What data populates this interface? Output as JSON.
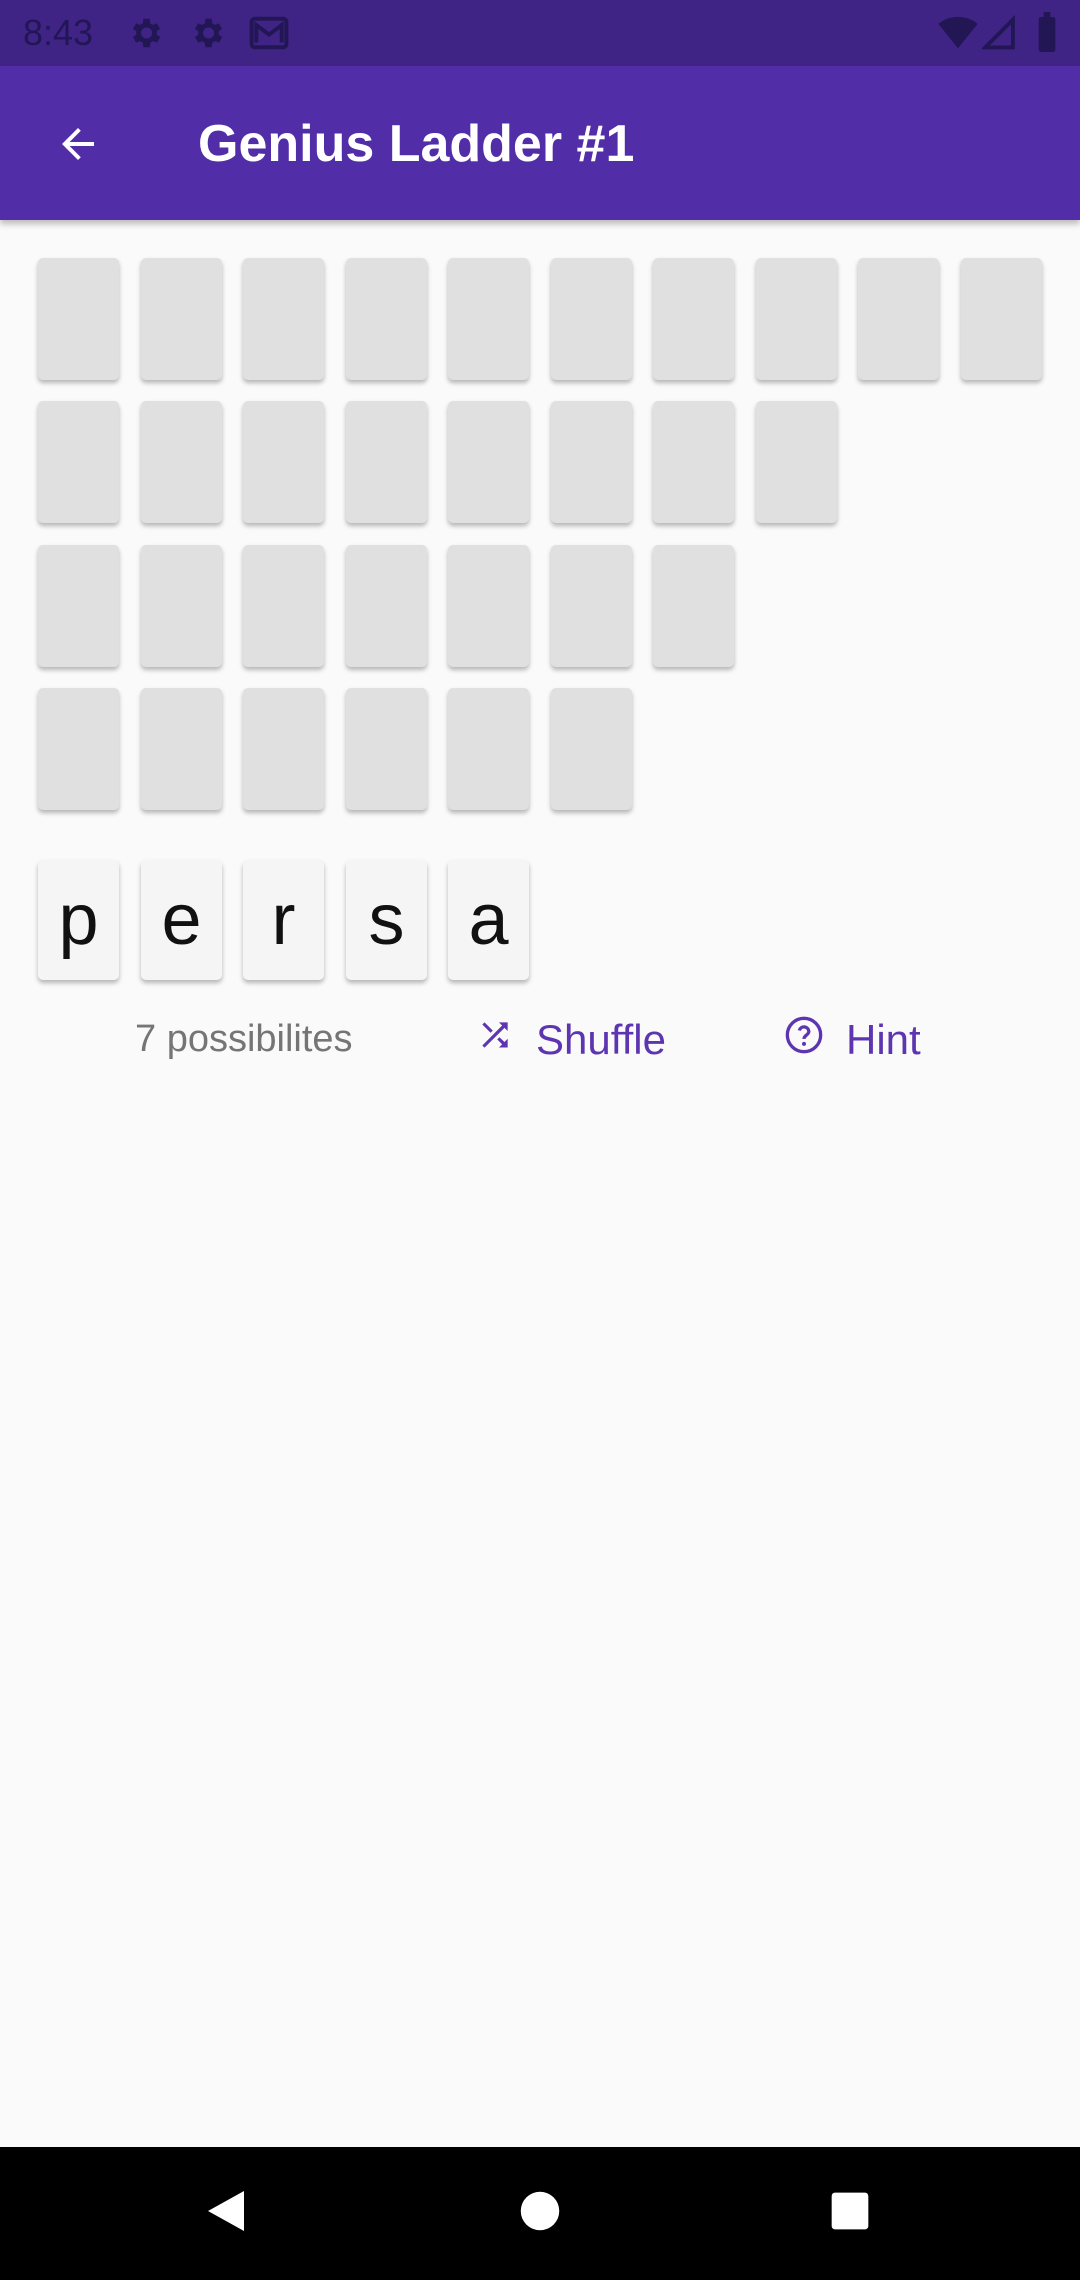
{
  "status_bar": {
    "time": "8:43",
    "icons": [
      "gear-icon",
      "gear-icon",
      "gmail-icon",
      "wifi-icon",
      "signal-icon",
      "battery-icon"
    ]
  },
  "app_bar": {
    "title": "Genius Ladder #1",
    "back_icon": "arrow-back-icon"
  },
  "board": {
    "rows": [
      {
        "word_length": 10
      },
      {
        "word_length": 8
      },
      {
        "word_length": 7
      },
      {
        "word_length": 6
      }
    ]
  },
  "letters": [
    "p",
    "e",
    "r",
    "s",
    "a"
  ],
  "controls": {
    "possibilities": "7 possibilites",
    "shuffle_label": "Shuffle",
    "shuffle_icon": "shuffle-icon",
    "hint_label": "Hint",
    "hint_icon": "help-circle-icon"
  },
  "colors": {
    "primary": "#512DA8",
    "status_bar": "#3F2486",
    "accent_text": "#5E35B1",
    "tile": "#E0E0E0",
    "background": "#FAFAFA"
  },
  "nav_bar": {
    "icons": [
      "back-triangle-icon",
      "home-circle-icon",
      "recents-square-icon"
    ]
  }
}
